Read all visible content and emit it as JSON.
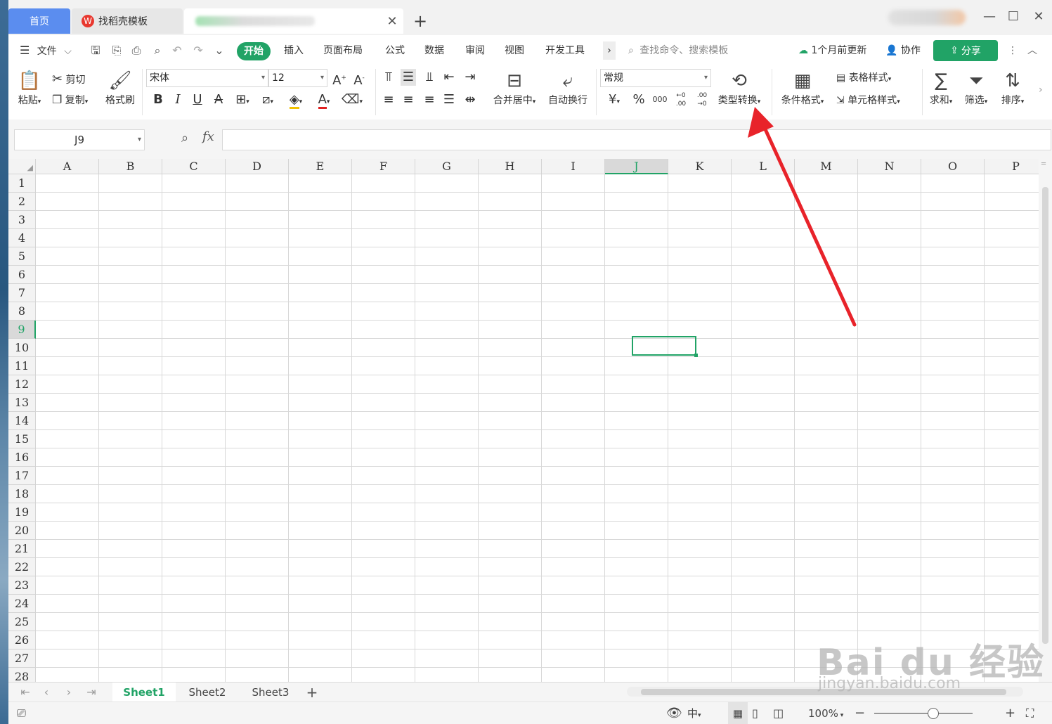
{
  "titlebar": {
    "tabs": [
      {
        "label": "首页"
      },
      {
        "label": "找稻壳模板",
        "logo": "W"
      }
    ],
    "new_tab": "+",
    "window_controls": [
      "—",
      "☐",
      "✕"
    ]
  },
  "menu": {
    "file_label": "文件",
    "tabs": [
      "开始",
      "插入",
      "页面布局",
      "公式",
      "数据",
      "审阅",
      "视图",
      "开发工具"
    ],
    "more": "›",
    "search_placeholder": "查找命令、搜索模板",
    "update_status": "1个月前更新",
    "collaborate": "协作",
    "share": "分享"
  },
  "ribbon": {
    "paste": "粘贴",
    "cut": "剪切",
    "copy": "复制",
    "format_painter": "格式刷",
    "font_name": "宋体",
    "font_size": "12",
    "bold": "B",
    "italic": "I",
    "underline": "U",
    "merge_center": "合并居中",
    "wrap_text": "自动换行",
    "number_format": "常规",
    "currency": "¥",
    "percent": "%",
    "thousands": "000",
    "inc_decimal": "←0 .00",
    "dec_decimal": ".00 →0",
    "type_convert": "类型转换",
    "conditional_format": "条件格式",
    "table_style": "表格样式",
    "cell_style": "单元格样式",
    "sum": "求和",
    "filter": "筛选",
    "sort": "排序"
  },
  "formula_bar": {
    "cell_ref": "J9",
    "fx": "fx",
    "value": ""
  },
  "grid": {
    "columns": [
      "A",
      "B",
      "C",
      "D",
      "E",
      "F",
      "G",
      "H",
      "I",
      "J",
      "K",
      "L",
      "M",
      "N",
      "O",
      "P"
    ],
    "rows": [
      "1",
      "2",
      "3",
      "4",
      "5",
      "6",
      "7",
      "8",
      "9",
      "10",
      "11",
      "12",
      "13",
      "14",
      "15",
      "16",
      "17",
      "18",
      "19",
      "20",
      "21",
      "22",
      "23",
      "24",
      "25",
      "26",
      "27",
      "28"
    ],
    "active_column": "J",
    "active_row": "9"
  },
  "sheets": {
    "tabs": [
      "Sheet1",
      "Sheet2",
      "Sheet3"
    ],
    "active": "Sheet1",
    "add": "+"
  },
  "status": {
    "zoom": "100%"
  },
  "watermark": {
    "brand": "Bai du 经验",
    "url": "jingyan.baidu.com"
  },
  "colors": {
    "accent_green": "#21a366",
    "home_tab_blue": "#5b8def",
    "arrow_red": "#e8232a"
  }
}
